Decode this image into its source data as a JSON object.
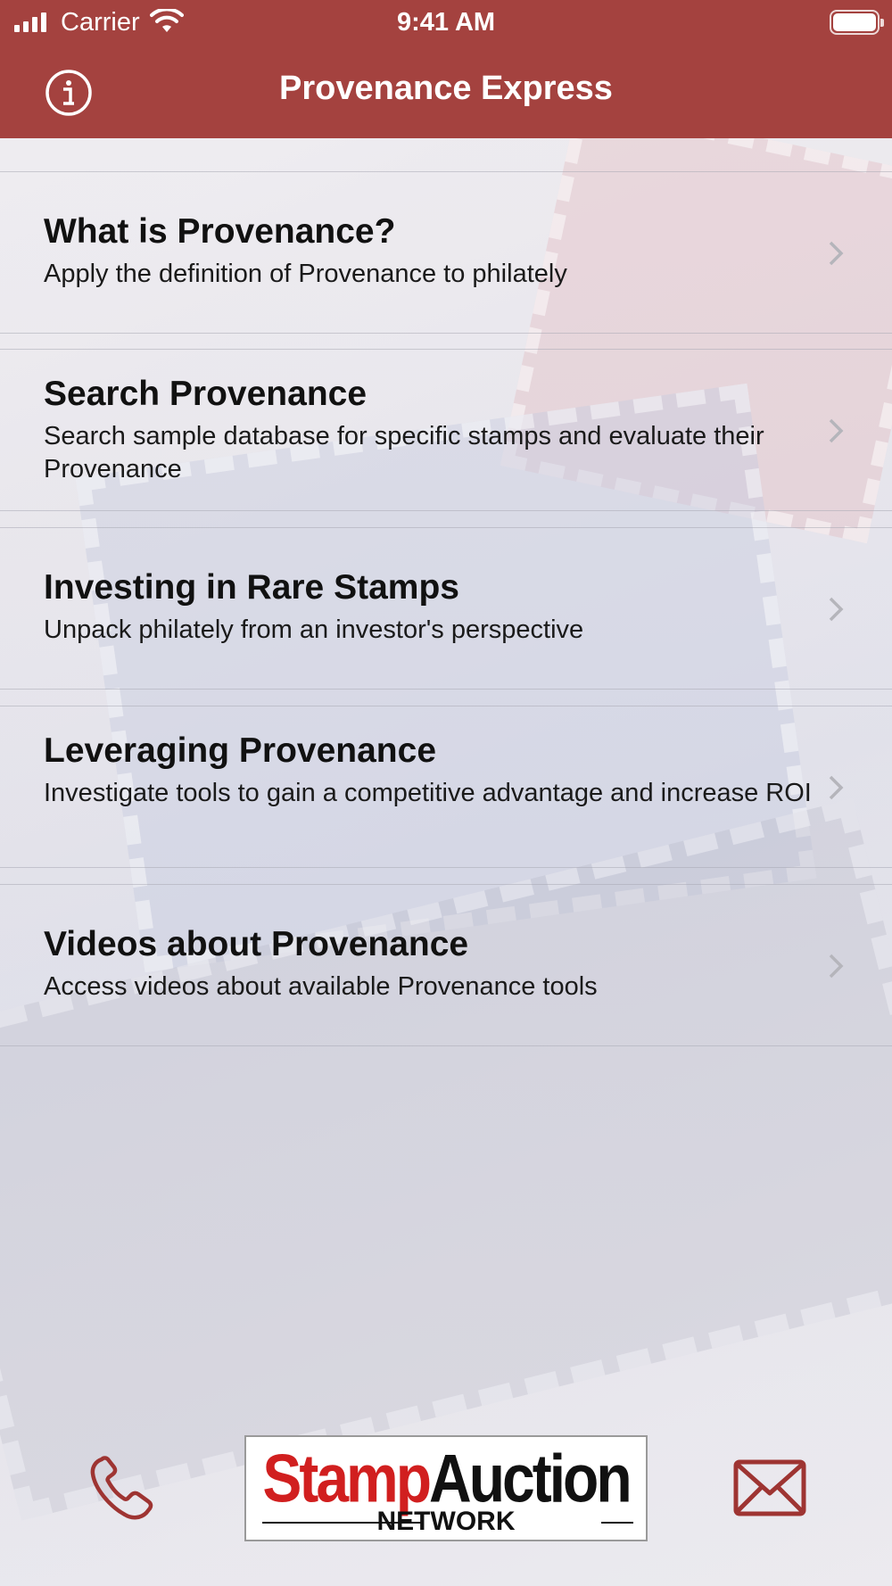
{
  "status_bar": {
    "carrier": "Carrier",
    "time": "9:41 AM"
  },
  "nav": {
    "title": "Provenance Express",
    "info_icon": "info-circle-icon"
  },
  "menu": [
    {
      "title": "What is Provenance?",
      "subtitle": "Apply the definition of Provenance to philately"
    },
    {
      "title": "Search Provenance",
      "subtitle": "Search sample database for specific stamps and evaluate their Provenance"
    },
    {
      "title": "Investing in Rare Stamps",
      "subtitle": "Unpack philately from an investor's perspective"
    },
    {
      "title": "Leveraging Provenance",
      "subtitle": "Investigate tools to gain a competitive advantage and increase ROI"
    },
    {
      "title": "Videos about Provenance",
      "subtitle": "Access videos about available Provenance tools"
    }
  ],
  "footer": {
    "phone_icon": "phone-icon",
    "mail_icon": "mail-icon",
    "logo": {
      "word1": "Stamp",
      "word2": "Auction",
      "word3": "NETWORK"
    }
  },
  "colors": {
    "header": "#a4423f",
    "accent_icon": "#9e3432",
    "logo_red": "#d11f1f"
  }
}
